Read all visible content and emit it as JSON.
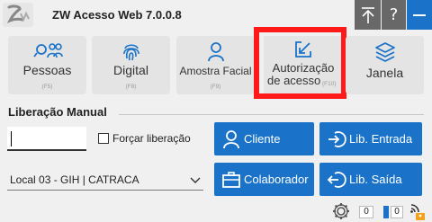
{
  "app": {
    "title": "ZW Acesso Web 7.0.0.8"
  },
  "titlebar": {
    "pin_icon": "pin-icon",
    "help_label": "?",
    "minimize_icon": "minimize-icon"
  },
  "tiles": [
    {
      "label": "Pessoas",
      "shortcut": "(F5)",
      "icon": "people-icon"
    },
    {
      "label": "Digital",
      "shortcut": "(F8)",
      "icon": "fingerprint-icon"
    },
    {
      "label": "Amostra Facial",
      "shortcut": "(F9)",
      "icon": "person-icon"
    },
    {
      "label_line1": "Autorização",
      "label_line2": "de acesso",
      "shortcut": "(F10)",
      "icon": "edit-arrow-icon"
    },
    {
      "label": "Janela",
      "icon": "layers-icon"
    }
  ],
  "manual": {
    "title": "Liberação Manual",
    "input_value": "",
    "force_label": "Forçar liberação",
    "force_checked": false,
    "location_selected": "Local 03 - GIH | CATRACA"
  },
  "actions": {
    "cliente": "Cliente",
    "lib_entrada": "Lib. Entrada",
    "colaborador": "Colaborador",
    "lib_saida": "Lib. Saída"
  },
  "footer": {
    "count_a": "0",
    "count_b": "0"
  },
  "colors": {
    "accent": "#1a73c8",
    "highlight": "#ff1a1a",
    "titlebar_button": "#686868"
  }
}
